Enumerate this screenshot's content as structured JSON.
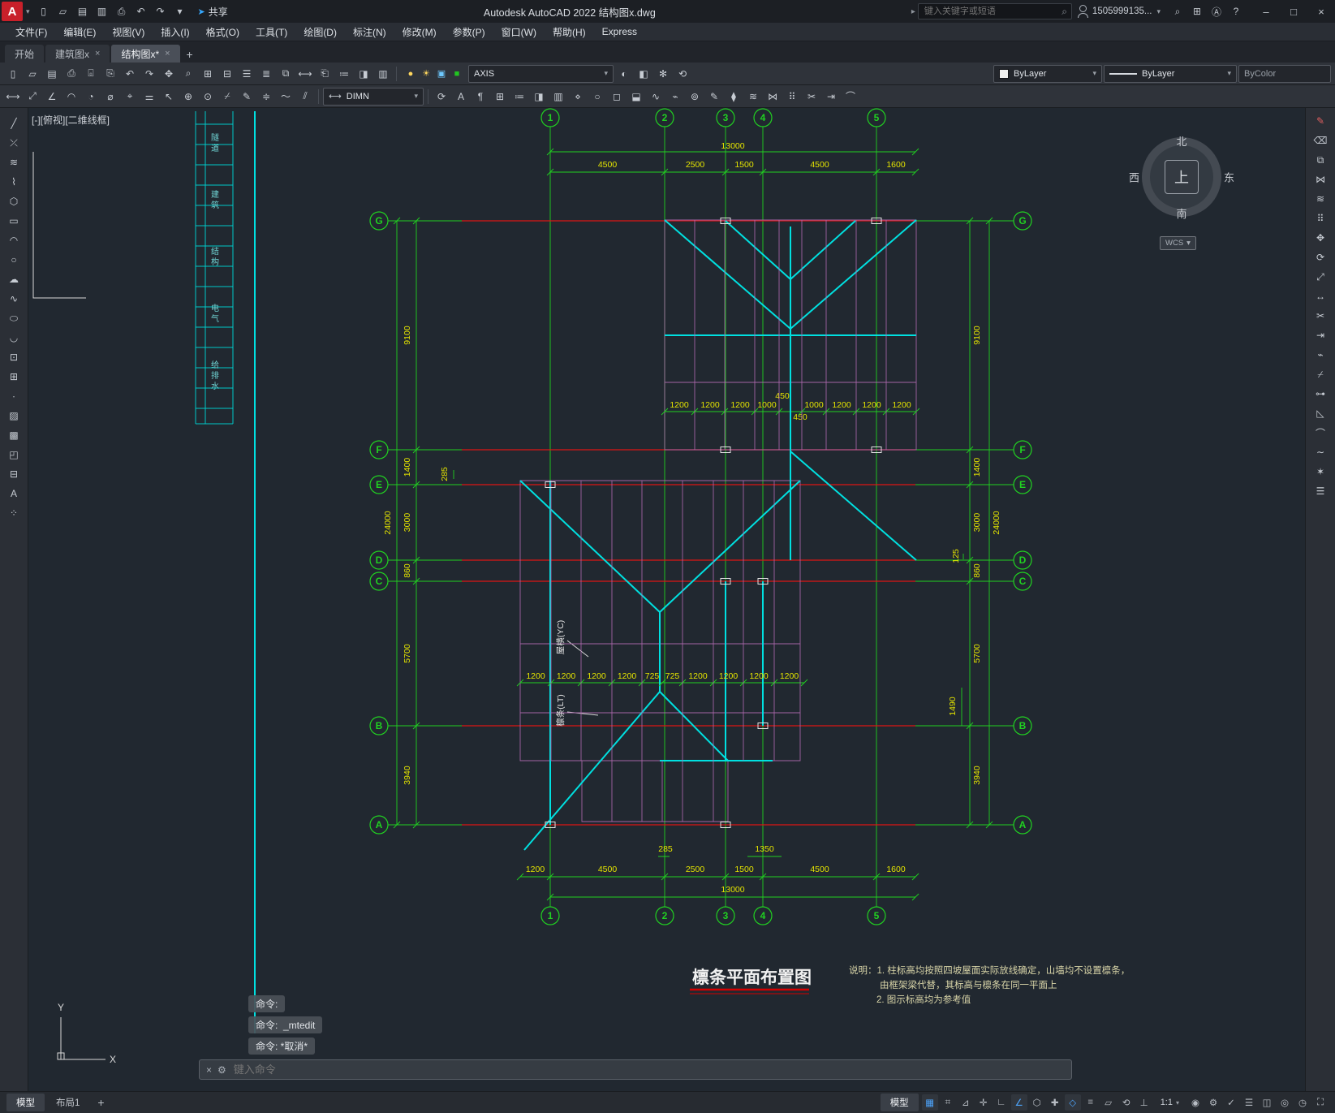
{
  "ui_glyphs": {
    "chevron": "▾",
    "tab_close": "×",
    "collapse_arrow": "▸",
    "logo_arrow": "▾"
  },
  "titlebar": {
    "logo_letter": "A",
    "title": "Autodesk AutoCAD 2022   结构图x.dwg",
    "share_label": "共享",
    "share_icon_glyph": "➤",
    "search_placeholder": "键入关键字或短语",
    "account_label": "1505999135...",
    "quick_icons": [
      {
        "name": "new-file",
        "glyph": "▯"
      },
      {
        "name": "open-file",
        "glyph": "▱"
      },
      {
        "name": "save",
        "glyph": "▤"
      },
      {
        "name": "save-as",
        "glyph": "▥"
      },
      {
        "name": "plot",
        "glyph": "⎙"
      },
      {
        "name": "undo",
        "glyph": "↶"
      },
      {
        "name": "redo",
        "glyph": "↷"
      },
      {
        "name": "workspace-dropdown",
        "glyph": "▾"
      }
    ],
    "right_icons": [
      {
        "name": "search",
        "glyph": "⌕"
      },
      {
        "name": "app-store",
        "glyph": "⊞"
      },
      {
        "name": "autodesk-apps",
        "glyph": "Ⓐ"
      },
      {
        "name": "help",
        "glyph": "?"
      }
    ],
    "window_buttons": [
      {
        "name": "minimize",
        "glyph": "–"
      },
      {
        "name": "maximize",
        "glyph": "□"
      },
      {
        "name": "close",
        "glyph": "×"
      }
    ]
  },
  "menubar": [
    "文件(F)",
    "编辑(E)",
    "视图(V)",
    "插入(I)",
    "格式(O)",
    "工具(T)",
    "绘图(D)",
    "标注(N)",
    "修改(M)",
    "参数(P)",
    "窗口(W)",
    "帮助(H)",
    "Express"
  ],
  "doc_tabs": [
    {
      "label": "开始",
      "closable": false,
      "active": false
    },
    {
      "label": "建筑图x",
      "closable": true,
      "active": false
    },
    {
      "label": "结构图x*",
      "closable": true,
      "active": true
    }
  ],
  "new_tab_glyph": "+",
  "ribbon": {
    "row1_icons": [
      {
        "name": "new",
        "glyph": "▯"
      },
      {
        "name": "open",
        "glyph": "▱"
      },
      {
        "name": "save",
        "glyph": "▤"
      },
      {
        "name": "plot",
        "glyph": "⎙"
      },
      {
        "name": "plot-preview",
        "glyph": "⌻"
      },
      {
        "name": "publish",
        "glyph": "⎘"
      },
      {
        "name": "undo",
        "glyph": "↶"
      },
      {
        "name": "redo",
        "glyph": "↷"
      },
      {
        "name": "pan",
        "glyph": "✥"
      },
      {
        "name": "zoom-realtime",
        "glyph": "⌕"
      },
      {
        "name": "zoom-window",
        "glyph": "⊞"
      },
      {
        "name": "zoom-previous",
        "glyph": "⊟"
      },
      {
        "name": "properties",
        "glyph": "☰"
      },
      {
        "name": "layer-properties",
        "glyph": "≣"
      },
      {
        "name": "match-properties",
        "glyph": "⧉"
      },
      {
        "name": "measure",
        "glyph": "⟷"
      },
      {
        "name": "paste",
        "glyph": "⎗"
      },
      {
        "name": "field",
        "glyph": "≔"
      },
      {
        "name": "view-manager",
        "glyph": "◨"
      },
      {
        "name": "sheet-set",
        "glyph": "▥"
      }
    ],
    "layer_toggles": [
      {
        "name": "layer-on",
        "glyph": "●",
        "color": "#ffd75e"
      },
      {
        "name": "layer-thaw",
        "glyph": "☀",
        "color": "#ffd75e"
      },
      {
        "name": "layer-unlock",
        "glyph": "▣",
        "color": "#6ec9ff"
      },
      {
        "name": "layer-color",
        "glyph": "■",
        "color": "#21c521"
      }
    ],
    "layer_combo_value": "AXIS",
    "row1_mid_icons": [
      {
        "name": "layer-off",
        "glyph": "◐"
      },
      {
        "name": "layer-isolate",
        "glyph": "◧"
      },
      {
        "name": "layer-freeze",
        "glyph": "✻"
      },
      {
        "name": "layer-previous",
        "glyph": "⟲"
      }
    ],
    "color_combo_value": "ByLayer",
    "linetype_combo_value": "ByLayer",
    "plotstyle_value": "ByColor",
    "row2_icons_left": [
      {
        "name": "dim-linear",
        "glyph": "⟷"
      },
      {
        "name": "dim-aligned",
        "glyph": "⤢"
      },
      {
        "name": "dim-angular",
        "glyph": "∠"
      },
      {
        "name": "dim-arc",
        "glyph": "◠"
      },
      {
        "name": "dim-radius",
        "glyph": "◔"
      },
      {
        "name": "dim-diameter",
        "glyph": "⌀"
      },
      {
        "name": "dim-ordinate",
        "glyph": "⌖"
      },
      {
        "name": "quick-dim",
        "glyph": "⚌"
      },
      {
        "name": "mleader",
        "glyph": "↖"
      },
      {
        "name": "tolerance",
        "glyph": "⊕"
      },
      {
        "name": "center-mark",
        "glyph": "⊙"
      },
      {
        "name": "dim-break",
        "glyph": "⌿"
      },
      {
        "name": "edit-dim",
        "glyph": "✎"
      },
      {
        "name": "dim-space",
        "glyph": "≑"
      },
      {
        "name": "dim-jog",
        "glyph": "〜"
      },
      {
        "name": "dim-oblique",
        "glyph": "⫽"
      }
    ],
    "dimstyle_combo_value": "DIMN",
    "dimstyle_icon_glyph": "⟷",
    "row2_icons_right": [
      {
        "name": "dim-update",
        "glyph": "⟳"
      },
      {
        "name": "text-style",
        "glyph": "A"
      },
      {
        "name": "mtext",
        "glyph": "¶"
      },
      {
        "name": "table-insert",
        "glyph": "⊞"
      },
      {
        "name": "field-insert",
        "glyph": "≔"
      },
      {
        "name": "block-edit",
        "glyph": "◨"
      },
      {
        "name": "xref-attach",
        "glyph": "▥"
      },
      {
        "name": "point-tool",
        "glyph": "⋄"
      },
      {
        "name": "circle-tool",
        "glyph": "○"
      },
      {
        "name": "rect-tool",
        "glyph": "◻"
      },
      {
        "name": "wipeout",
        "glyph": "⬓"
      },
      {
        "name": "spline-edit",
        "glyph": "∿"
      },
      {
        "name": "break-tool",
        "glyph": "⌁"
      },
      {
        "name": "donut",
        "glyph": "⊚"
      },
      {
        "name": "edit-polyline",
        "glyph": "✎"
      },
      {
        "name": "solid-fill",
        "glyph": "⧫"
      },
      {
        "name": "offset-tool",
        "glyph": "≋"
      },
      {
        "name": "mirror-tool",
        "glyph": "⋈"
      },
      {
        "name": "array-tool",
        "glyph": "⠿"
      },
      {
        "name": "trim-tool",
        "glyph": "✂"
      },
      {
        "name": "extend-tool",
        "glyph": "⇥"
      },
      {
        "name": "fillet-tool",
        "glyph": "⌒"
      }
    ]
  },
  "left_toolbar": [
    {
      "name": "line",
      "glyph": "╱"
    },
    {
      "name": "construction-line",
      "glyph": "⤫"
    },
    {
      "name": "multiline",
      "glyph": "≋"
    },
    {
      "name": "polyline",
      "glyph": "⌇"
    },
    {
      "name": "polygon",
      "glyph": "⬡"
    },
    {
      "name": "rectangle",
      "glyph": "▭"
    },
    {
      "name": "arc",
      "glyph": "◠"
    },
    {
      "name": "circle",
      "glyph": "○"
    },
    {
      "name": "revision-cloud",
      "glyph": "☁"
    },
    {
      "name": "spline",
      "glyph": "∿"
    },
    {
      "name": "ellipse",
      "glyph": "⬭"
    },
    {
      "name": "ellipse-arc",
      "glyph": "◡"
    },
    {
      "name": "insert-block",
      "glyph": "⊡"
    },
    {
      "name": "create-block",
      "glyph": "⊞"
    },
    {
      "name": "point",
      "glyph": "∙"
    },
    {
      "name": "hatch",
      "glyph": "▨"
    },
    {
      "name": "gradient",
      "glyph": "▩"
    },
    {
      "name": "region",
      "glyph": "◰"
    },
    {
      "name": "table-tool",
      "glyph": "⊟"
    },
    {
      "name": "mtext-tool",
      "glyph": "A"
    },
    {
      "name": "point-style",
      "glyph": "⁘"
    }
  ],
  "right_toolbar": [
    {
      "name": "edit-pencil",
      "glyph": "✎",
      "color": "#e06060"
    },
    {
      "name": "erase",
      "glyph": "⌫"
    },
    {
      "name": "copy",
      "glyph": "⧉"
    },
    {
      "name": "mirror",
      "glyph": "⋈"
    },
    {
      "name": "offset",
      "glyph": "≋"
    },
    {
      "name": "array",
      "glyph": "⠿"
    },
    {
      "name": "move",
      "glyph": "✥"
    },
    {
      "name": "rotate",
      "glyph": "⟳"
    },
    {
      "name": "scale",
      "glyph": "⤢"
    },
    {
      "name": "stretch",
      "glyph": "↔"
    },
    {
      "name": "trim",
      "glyph": "✂"
    },
    {
      "name": "extend",
      "glyph": "⇥"
    },
    {
      "name": "break-point",
      "glyph": "⌁"
    },
    {
      "name": "break",
      "glyph": "⌿"
    },
    {
      "name": "join",
      "glyph": "⊶"
    },
    {
      "name": "chamfer",
      "glyph": "◺"
    },
    {
      "name": "fillet",
      "glyph": "⌒"
    },
    {
      "name": "blend",
      "glyph": "∼"
    },
    {
      "name": "explode",
      "glyph": "✶"
    },
    {
      "name": "properties-panel",
      "glyph": "☰"
    }
  ],
  "canvas": {
    "viewport_label": "[-][俯视][二维线框]",
    "compass": {
      "north": "北",
      "south": "南",
      "west": "西",
      "east": "东",
      "center": "上",
      "wcs_label": "WCS"
    },
    "command_history": [
      "命令:",
      "命令:  _mtedit",
      "命令: *取消*"
    ],
    "command_placeholder": "键入命令",
    "ucs_x": "X",
    "ucs_y": "Y"
  },
  "drawing": {
    "title": "檩条平面布置图",
    "notes": [
      "说明：1. 柱标高均按照四坡屋面实际放线确定，山墙均不设置檩条，",
      "由框架梁代替，其标高与檩条在同一平面上",
      "2. 图示标高均为参考值"
    ],
    "axis_cols": [
      "1",
      "2",
      "3",
      "4",
      "5"
    ],
    "axis_rows": [
      "G",
      "F",
      "E",
      "D",
      "C",
      "B",
      "A"
    ],
    "dim_top_total": "13000",
    "dims_top": [
      "4500",
      "2500",
      "1500",
      "4500",
      "1600"
    ],
    "dim_bottom_total": "13000",
    "dims_bottom": [
      "1200",
      "4500",
      "2500",
      "1500",
      "4500",
      "1600"
    ],
    "dims_bottom_small": [
      "285",
      "1350"
    ],
    "dim_left_total": "24000",
    "dims_left": [
      "9100",
      "1400",
      "3000",
      "860",
      "5700",
      "3940"
    ],
    "dim_left_small": "285",
    "dim_right_total": "24000",
    "dims_right": [
      "9100",
      "1400",
      "3000",
      "860",
      "5700",
      "3940"
    ],
    "dims_right_small": [
      "125",
      "1490"
    ],
    "purlin_dims_upper": [
      "1200",
      "1200",
      "1200",
      "1000",
      "1000",
      "1200",
      "1200",
      "1200"
    ],
    "purlin_dims_upper_center": [
      "450",
      "450"
    ],
    "purlin_dims_lower": [
      "1200",
      "1200",
      "1200",
      "1200",
      "725",
      "725",
      "1200",
      "1200",
      "1200",
      "1200"
    ],
    "component_labels": [
      "屋横(YC)",
      "檩条(LT)"
    ],
    "sheet_strip_texts": [
      "隧道",
      "建筑",
      "结构",
      "电气",
      "给排水"
    ]
  },
  "statusbar": {
    "layout_tabs": [
      {
        "label": "模型",
        "active": true
      },
      {
        "label": "布局1",
        "active": false
      }
    ],
    "add_layout_glyph": "+",
    "model_button": "模型",
    "annotation_scale": "1:1",
    "right_icons": [
      {
        "name": "grid-display",
        "glyph": "▦",
        "active": true
      },
      {
        "name": "snap-mode",
        "glyph": "⌗"
      },
      {
        "name": "infer-constraints",
        "glyph": "⊿"
      },
      {
        "name": "dynamic-input",
        "glyph": "✛"
      },
      {
        "name": "ortho-mode",
        "glyph": "∟"
      },
      {
        "name": "polar-tracking",
        "glyph": "∠",
        "active": true
      },
      {
        "name": "isometric-drafting",
        "glyph": "⬡"
      },
      {
        "name": "object-snap-tracking",
        "glyph": "✚"
      },
      {
        "name": "object-snap",
        "glyph": "◇",
        "active": true
      },
      {
        "name": "lineweight",
        "glyph": "≡"
      },
      {
        "name": "transparency",
        "glyph": "▱"
      },
      {
        "name": "selection-cycling",
        "glyph": "⟲"
      },
      {
        "name": "dynamic-ucs",
        "glyph": "⊥"
      }
    ],
    "right_icons2": [
      {
        "name": "annotation-visibility",
        "glyph": "◉"
      },
      {
        "name": "workspace-switching",
        "glyph": "⚙"
      },
      {
        "name": "annotation-monitor",
        "glyph": "✓"
      },
      {
        "name": "quick-properties",
        "glyph": "☰"
      },
      {
        "name": "lock-ui",
        "glyph": "◫"
      },
      {
        "name": "isolate-objects",
        "glyph": "◎"
      },
      {
        "name": "graphics-performance",
        "glyph": "◷"
      },
      {
        "name": "clean-screen",
        "glyph": "⛶"
      }
    ]
  }
}
